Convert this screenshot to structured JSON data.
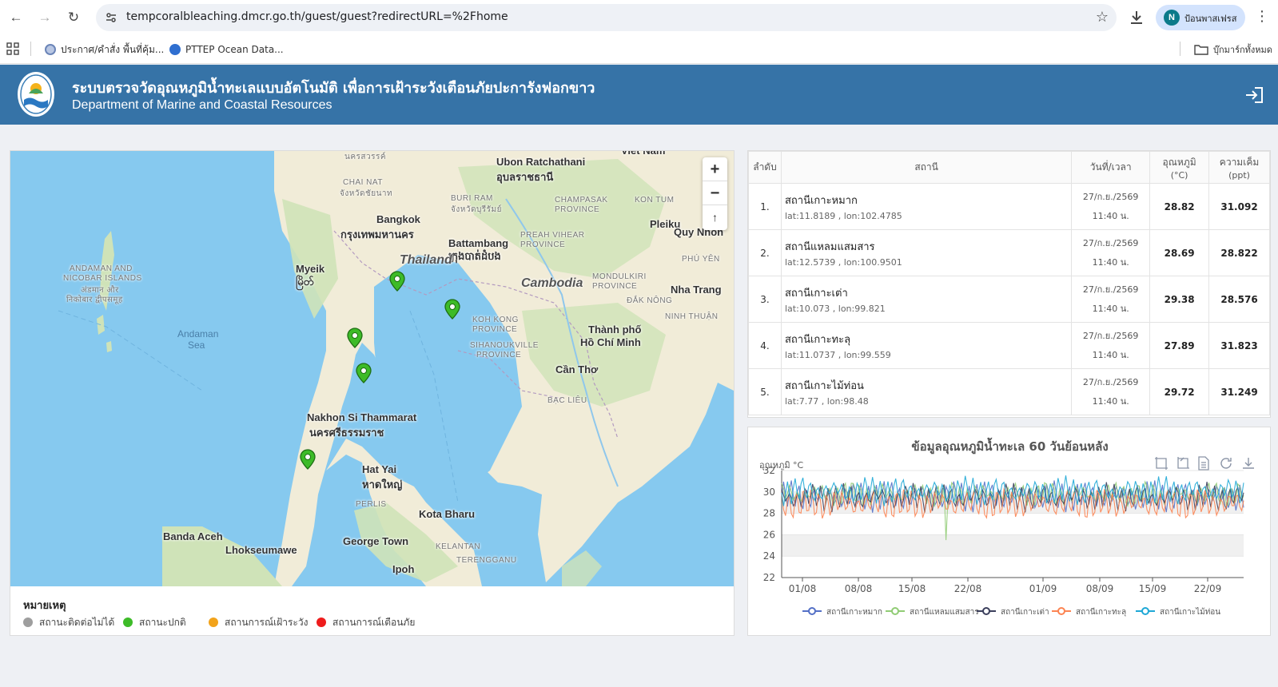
{
  "browser": {
    "url": "tempcoralbleaching.dmcr.go.th/guest/guest?redirectURL=%2Fhome",
    "profile_initial": "N",
    "profile_name": "ป้อนพาสเฟรส",
    "bookmarks": [
      {
        "label": "ประกาศ/คำสั่ง พื้นที่คุ้ม..."
      },
      {
        "label": "PTTEP Ocean Data..."
      }
    ],
    "all_bookmarks_label": "บุ๊กมาร์กทั้งหมด"
  },
  "header": {
    "title_th": "ระบบตรวจวัดอุณหภูมิน้ำทะเลแบบอัตโนมัติ เพื่อการเฝ้าระวังเตือนภัยปะการังฟอกขาว",
    "title_en": "Department of Marine and Coastal Resources"
  },
  "map": {
    "zoom_in": "+",
    "zoom_out": "−",
    "reset": "↑",
    "labels": [
      {
        "text": "นครสวรรค์",
        "cls": "small"
      },
      {
        "text": "Ubon Ratchathani",
        "cls": ""
      },
      {
        "text": "อุบลราชธานี",
        "cls": ""
      },
      {
        "text": "Viet Nam",
        "cls": ""
      },
      {
        "text": "CHAI NAT",
        "cls": "small"
      },
      {
        "text": "จังหวัดชัยนาท",
        "cls": "small"
      },
      {
        "text": "BURI RAM",
        "cls": "small"
      },
      {
        "text": "จังหวัดบุรีรัมย์",
        "cls": "small"
      },
      {
        "text": "CHAMPASAK",
        "cls": "small"
      },
      {
        "text": "PROVINCE",
        "cls": "small"
      },
      {
        "text": "KON TUM",
        "cls": "small"
      },
      {
        "text": "Bangkok",
        "cls": ""
      },
      {
        "text": "กรุงเทพมหานคร",
        "cls": ""
      },
      {
        "text": "Pleiku",
        "cls": ""
      },
      {
        "text": "Quy Nhon",
        "cls": ""
      },
      {
        "text": "PREAH VIHEAR",
        "cls": "small"
      },
      {
        "text": "PROVINCE",
        "cls": "small"
      },
      {
        "text": "Battambang",
        "cls": ""
      },
      {
        "text": "ក្រុងបាត់ដំបង",
        "cls": ""
      },
      {
        "text": "Thailand",
        "cls": "country"
      },
      {
        "text": "PHÚ YÊN",
        "cls": "small"
      },
      {
        "text": "ANDAMAN AND",
        "cls": "small"
      },
      {
        "text": "NICOBAR ISLANDS",
        "cls": "small"
      },
      {
        "text": "अंडमान और",
        "cls": "small"
      },
      {
        "text": "निकोबार द्वीपसमूह",
        "cls": "small"
      },
      {
        "text": "Myeik",
        "cls": ""
      },
      {
        "text": "မြိတ်",
        "cls": ""
      },
      {
        "text": "Cambodia",
        "cls": "country"
      },
      {
        "text": "MONDULKIRI",
        "cls": "small"
      },
      {
        "text": "PROVINCE",
        "cls": "small"
      },
      {
        "text": "Nha Trang",
        "cls": ""
      },
      {
        "text": "ĐẮK NÔNG",
        "cls": "small"
      },
      {
        "text": "NINH THUẬN",
        "cls": "small"
      },
      {
        "text": "KOH KONG",
        "cls": "small"
      },
      {
        "text": "PROVINCE",
        "cls": "small"
      },
      {
        "text": "Andaman",
        "cls": "water"
      },
      {
        "text": "Sea",
        "cls": "water"
      },
      {
        "text": "Thành phố",
        "cls": ""
      },
      {
        "text": "Hồ Chí Minh",
        "cls": ""
      },
      {
        "text": "SIHANOUKVILLE",
        "cls": "small"
      },
      {
        "text": "PROVINCE",
        "cls": "small"
      },
      {
        "text": "Cần Thơ",
        "cls": ""
      },
      {
        "text": "BẠC LIÊU",
        "cls": "small"
      },
      {
        "text": "Nakhon Si Thammarat",
        "cls": ""
      },
      {
        "text": "นครศรีธรรมราช",
        "cls": ""
      },
      {
        "text": "Hat Yai",
        "cls": ""
      },
      {
        "text": "หาดใหญ่",
        "cls": ""
      },
      {
        "text": "PERLIS",
        "cls": "small"
      },
      {
        "text": "Kota Bharu",
        "cls": ""
      },
      {
        "text": "Banda Aceh",
        "cls": ""
      },
      {
        "text": "Lhokseumawe",
        "cls": ""
      },
      {
        "text": "George Town",
        "cls": ""
      },
      {
        "text": "KELANTAN",
        "cls": "small"
      },
      {
        "text": "TERENGGANU",
        "cls": "small"
      },
      {
        "text": "Ipoh",
        "cls": ""
      }
    ]
  },
  "legend": {
    "title": "หมายเหตุ",
    "items": [
      {
        "label": "สถานะติดต่อไม่ได้",
        "color": "#9e9e9e"
      },
      {
        "label": "สถานะปกติ",
        "color": "#3dbb28"
      },
      {
        "label": "สถานการณ์เฝ้าระวัง",
        "color": "#f2a31b"
      },
      {
        "label": "สถานการณ์เตือนภัย",
        "color": "#ee1c1c"
      }
    ]
  },
  "table": {
    "headers": {
      "order": "ลำดับ",
      "station": "สถานี",
      "datetime": "วันที่/เวลา",
      "temp_line1": "อุณหภูมิ",
      "temp_line2": "(°C)",
      "salinity_line1": "ความเค็ม",
      "salinity_line2": "(ppt)"
    },
    "rows": [
      {
        "no": "1.",
        "name": "สถานีเกาะหมาก",
        "coord": "lat:11.8189 , lon:102.4785",
        "date": "27/ก.ย./2569",
        "time": "11:40 น.",
        "temp": "28.82",
        "salinity": "31.092"
      },
      {
        "no": "2.",
        "name": "สถานีแหลมแสมสาร",
        "coord": "lat:12.5739 , lon:100.9501",
        "date": "27/ก.ย./2569",
        "time": "11:40 น.",
        "temp": "28.69",
        "salinity": "28.822"
      },
      {
        "no": "3.",
        "name": "สถานีเกาะเต่า",
        "coord": "lat:10.073 , lon:99.821",
        "date": "27/ก.ย./2569",
        "time": "11:40 น.",
        "temp": "29.38",
        "salinity": "28.576"
      },
      {
        "no": "4.",
        "name": "สถานีเกาะทะลุ",
        "coord": "lat:11.0737 , lon:99.559",
        "date": "27/ก.ย./2569",
        "time": "11:40 น.",
        "temp": "27.89",
        "salinity": "31.823"
      },
      {
        "no": "5.",
        "name": "สถานีเกาะไม้ท่อน",
        "coord": "lat:7.77 , lon:98.48",
        "date": "27/ก.ย./2569",
        "time": "11:40 น.",
        "temp": "29.72",
        "salinity": "31.249"
      }
    ]
  },
  "chart_data": {
    "type": "line",
    "title": "ข้อมูลอุณหภูมิน้ำทะเล 60 วันย้อนหลัง",
    "ylabel": "อุณหภูมิ °C",
    "ylim": [
      22,
      32
    ],
    "yticks": [
      22,
      24,
      26,
      28,
      30,
      32
    ],
    "xticks": [
      "01/08",
      "08/08",
      "15/08",
      "22/08",
      "01/09",
      "08/09",
      "15/09",
      "22/09"
    ],
    "x_range_days": [
      "29/07",
      "27/09"
    ],
    "legend_position": "bottom",
    "series": [
      {
        "name": "สถานีเกาะหมาก",
        "color": "#5470c6",
        "mean": 29.6,
        "amp": 0.9
      },
      {
        "name": "สถานีแหลมแสมสาร",
        "color": "#91cc75",
        "mean": 29.8,
        "amp": 0.7
      },
      {
        "name": "สถานีเกาะเต่า",
        "color": "#3b3f5c",
        "mean": 29.5,
        "amp": 0.8
      },
      {
        "name": "สถานีเกาะทะลุ",
        "color": "#fc8452",
        "mean": 28.9,
        "amp": 1.0
      },
      {
        "name": "สถานีเกาะไม้ท่อน",
        "color": "#1fa8d6",
        "mean": 30.1,
        "amp": 0.8
      }
    ]
  }
}
